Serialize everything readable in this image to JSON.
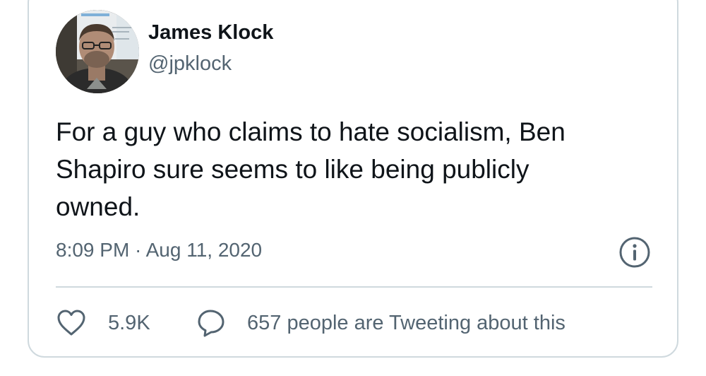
{
  "tweet": {
    "author": {
      "display_name": "James Klock",
      "handle": "@jpklock"
    },
    "text_lines": [
      "For a guy who claims to hate socialism, Ben",
      "Shapiro sure seems to like being publicly",
      "owned."
    ],
    "timestamp": "8:09 PM · Aug 11, 2020",
    "info_icon": "info-circle-icon"
  },
  "actions": {
    "like": {
      "icon": "heart-icon",
      "count": "5.9K"
    },
    "reply": {
      "icon": "speech-bubble-icon",
      "label": "657 people are Tweeting about this"
    }
  },
  "colors": {
    "primary_text": "#0f1419",
    "secondary_text": "#536471",
    "border": "#cfd9de"
  }
}
